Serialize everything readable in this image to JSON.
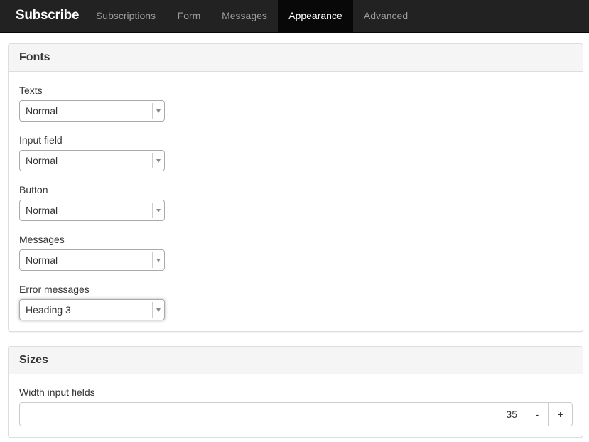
{
  "nav": {
    "brand": "Subscribe",
    "items": [
      {
        "label": "Subscriptions",
        "active": false
      },
      {
        "label": "Form",
        "active": false
      },
      {
        "label": "Messages",
        "active": false
      },
      {
        "label": "Appearance",
        "active": true
      },
      {
        "label": "Advanced",
        "active": false
      }
    ]
  },
  "fonts_panel": {
    "title": "Fonts",
    "fields": [
      {
        "label": "Texts",
        "value": "Normal"
      },
      {
        "label": "Input field",
        "value": "Normal"
      },
      {
        "label": "Button",
        "value": "Normal"
      },
      {
        "label": "Messages",
        "value": "Normal"
      },
      {
        "label": "Error messages",
        "value": "Heading 3"
      }
    ]
  },
  "sizes_panel": {
    "title": "Sizes",
    "width_label": "Width input fields",
    "width_value": "35",
    "minus_label": "-",
    "plus_label": "+"
  },
  "colors": {
    "navbar_bg": "#222222",
    "navbar_active_bg": "#080808",
    "nav_text": "#9d9d9d",
    "panel_heading_bg": "#f5f5f5"
  }
}
